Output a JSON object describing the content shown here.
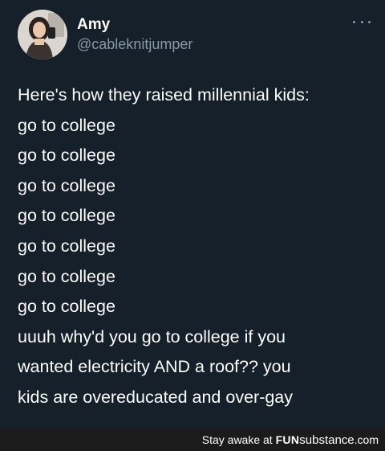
{
  "tweet": {
    "author": {
      "display_name": "Amy",
      "handle": "@cableknitjumper"
    },
    "lines": [
      "Here's how they raised millennial kids:",
      "go to college",
      "go to college",
      "go to college",
      "go to college",
      "go to college",
      "go to college",
      "go to college",
      "uuuh why'd you go to college if you",
      "wanted electricity AND a roof?? you",
      "kids are overeducated and over-gay"
    ]
  },
  "watermark": {
    "prefix": "Stay awake at",
    "brand_bold": "FUN",
    "brand_rest": "substance",
    "suffix": ".com"
  },
  "colors": {
    "background": "#15202b",
    "text": "#ffffff",
    "secondary_text": "#8899a6",
    "footer_bar": "#1b1b1b"
  }
}
